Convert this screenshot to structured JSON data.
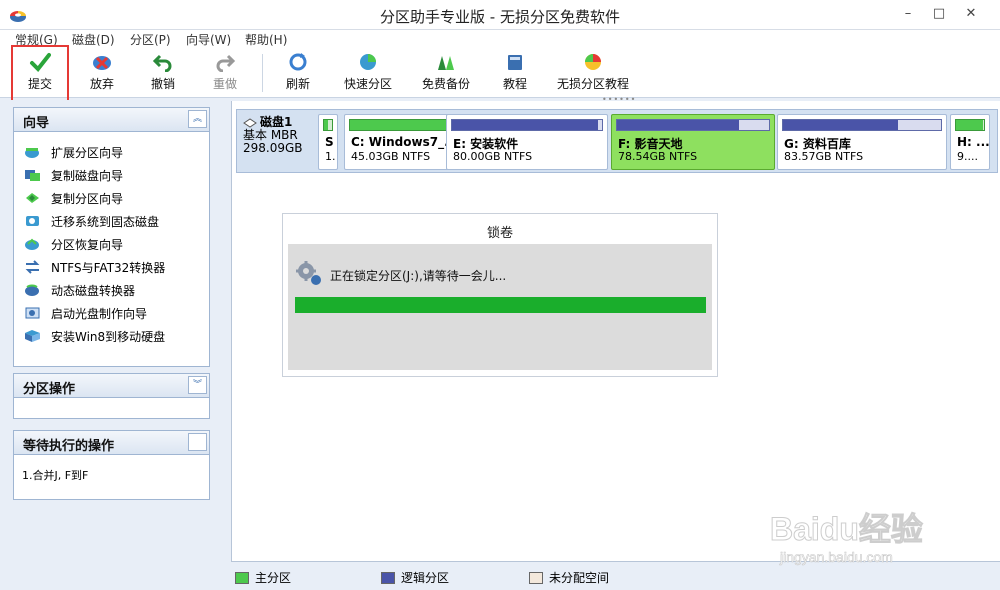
{
  "window": {
    "title": "分区助手专业版 - 无损分区免费软件",
    "minimize": "–",
    "maximize": "□",
    "close": "✕"
  },
  "menu": [
    "常规(G)",
    "磁盘(D)",
    "分区(P)",
    "向导(W)",
    "帮助(H)"
  ],
  "toolbar": {
    "commit": "提交",
    "discard": "放弃",
    "undo": "撤销",
    "redo": "重做",
    "refresh": "刷新",
    "quick_partition": "快速分区",
    "free_backup": "免费备份",
    "tutorial": "教程",
    "lossless_tutorial": "无损分区教程"
  },
  "sidebar": {
    "wizard_title": "向导",
    "wizard_items": [
      "扩展分区向导",
      "复制磁盘向导",
      "复制分区向导",
      "迁移系统到固态磁盘",
      "分区恢复向导",
      "NTFS与FAT32转换器",
      "动态磁盘转换器",
      "启动光盘制作向导",
      "安装Win8到移动硬盘"
    ],
    "partition_ops_title": "分区操作",
    "pending_title": "等待执行的操作",
    "pending_items": [
      "1.合并J, F到F"
    ]
  },
  "disk": {
    "name": "磁盘1",
    "type": "基本 MBR",
    "size": "298.09GB",
    "partitions": [
      {
        "name": "S",
        "size": "1.",
        "used": 0.5,
        "color": "green"
      },
      {
        "name": "C: Windows7_...",
        "size": "45.03GB NTFS",
        "used": 0.9,
        "color": "green"
      },
      {
        "name": "E: 安装软件",
        "size": "80.00GB NTFS",
        "used": 0.97,
        "color": "blue"
      },
      {
        "name": "F: 影音天地",
        "size": "78.54GB NTFS",
        "used": 0.8,
        "color": "blue",
        "selected": true
      },
      {
        "name": "G: 资料百库",
        "size": "83.57GB NTFS",
        "used": 0.73,
        "color": "blue"
      },
      {
        "name": "H: ...",
        "size": "9....",
        "used": 0.95,
        "color": "green"
      }
    ]
  },
  "dialog": {
    "title": "锁卷",
    "message": "正在锁定分区(J:),请等待一会儿...",
    "progress": 1.0
  },
  "legend": {
    "primary": "主分区",
    "logical": "逻辑分区",
    "unallocated": "未分配空间"
  },
  "colors": {
    "primary": "#4dc94d",
    "logical": "#4a54a8",
    "unallocated": "#f3e8dc",
    "accent": "#1aae2c",
    "highlight": "#e53935"
  },
  "watermark": {
    "brand": "Baidu经验",
    "url": "jingyan.baidu.com"
  }
}
